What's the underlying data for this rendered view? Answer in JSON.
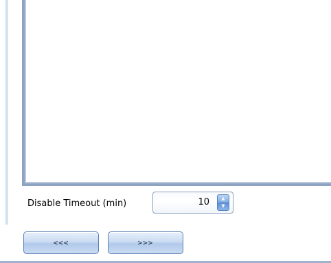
{
  "settings": {
    "timeout_label": "Disable Timeout (min)",
    "timeout_value": "10"
  },
  "icons": {
    "spin_up": "chevron-up-icon",
    "spin_down": "chevron-down-icon"
  },
  "navigation": {
    "prev_label": "<<<",
    "next_label": ">>>"
  },
  "colors": {
    "frame_border": "#8ea3c2",
    "button_border": "#5b7fb2",
    "spin_accent": "#5c8fd3"
  }
}
